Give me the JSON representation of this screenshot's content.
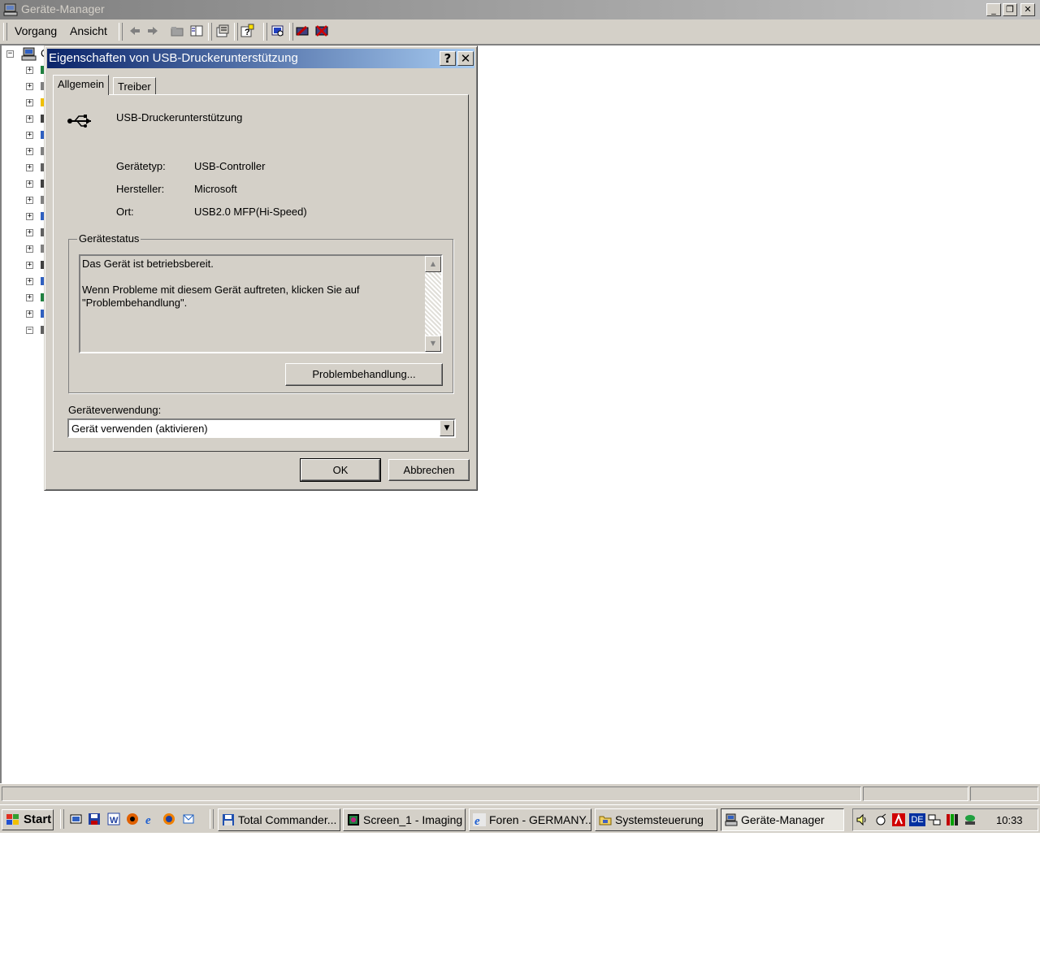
{
  "main_window": {
    "title": "Geräte-Manager",
    "menu": [
      "Vorgang",
      "Ansicht"
    ],
    "caption_buttons": [
      "minimize",
      "restore",
      "close"
    ]
  },
  "toolbar_icons": [
    "back-arrow-icon",
    "forward-arrow-icon",
    "up-folder-icon",
    "show-hide-tree-icon",
    "properties-icon",
    "help-icon",
    "scan-hardware-icon",
    "update-driver-icon",
    "uninstall-icon"
  ],
  "tree": {
    "root_label": "C",
    "node_count": 17,
    "last_expanded": true
  },
  "dialog": {
    "title": "Eigenschaften von USB-Druckerunterstützung",
    "help_button": "?",
    "close_button": "X",
    "tabs": [
      "Allgemein",
      "Treiber"
    ],
    "active_tab": "Allgemein",
    "device_name": "USB-Druckerunterstützung",
    "properties": {
      "type_label": "Gerätetyp:",
      "type_value": "USB-Controller",
      "vendor_label": "Hersteller:",
      "vendor_value": "Microsoft",
      "location_label": "Ort:",
      "location_value": "USB2.0 MFP(Hi-Speed)"
    },
    "status_group": {
      "legend": "Gerätestatus",
      "text": "Das Gerät ist betriebsbereit.\n\nWenn Probleme mit diesem Gerät auftreten, klicken Sie auf \"Problembehandlung\".",
      "troubleshoot_button": "Problembehandlung..."
    },
    "usage": {
      "label": "Geräteverwendung:",
      "selected": "Gerät verwenden (aktivieren)"
    },
    "ok_button": "OK",
    "cancel_button": "Abbrechen"
  },
  "taskbar": {
    "start_label": "Start",
    "quicklaunch_icons": [
      "show-desktop-icon",
      "save-icon",
      "word-icon",
      "media-player-icon",
      "internet-explorer-icon",
      "firefox-icon",
      "outlook-icon"
    ],
    "buttons": [
      {
        "label": "Total Commander...",
        "icon": "floppy-icon"
      },
      {
        "label": "Screen_1 - Imaging",
        "icon": "imaging-icon"
      },
      {
        "label": "Foren - GERMANY...",
        "icon": "internet-explorer-icon"
      },
      {
        "label": "Systemsteuerung",
        "icon": "control-panel-icon"
      },
      {
        "label": "Geräte-Manager",
        "icon": "computer-icon",
        "active": true
      }
    ],
    "tray_language": "DE",
    "clock": "10:33"
  },
  "colors": {
    "face": "#d4d0c8",
    "active_title_start": "#0a246a",
    "active_title_end": "#a6caf0",
    "inactive_title_start": "#808080",
    "inactive_title_end": "#c0c0c0"
  }
}
